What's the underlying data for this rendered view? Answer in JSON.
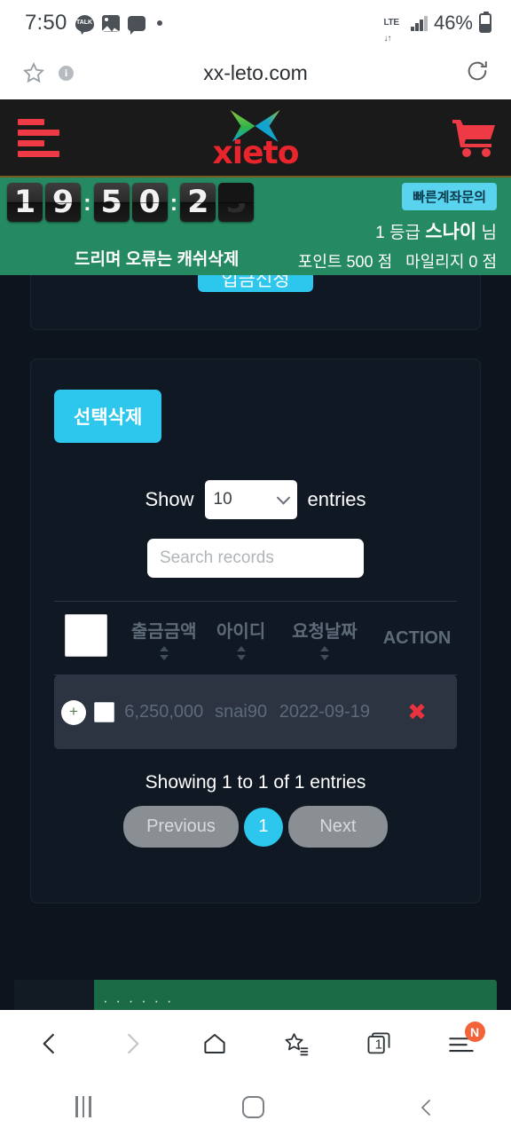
{
  "status_bar": {
    "time": "7:50",
    "icons": [
      "kakaotalk-icon",
      "gallery-icon",
      "message-icon",
      "dot-icon"
    ],
    "network": "LTE",
    "battery_percent": "46%"
  },
  "browser": {
    "url": "xx-leto.com",
    "star_icon": "bookmark-star-icon",
    "info_icon": "page-info-icon",
    "reload_icon": "reload-icon",
    "bottom": {
      "back": "back-arrow-icon",
      "forward": "forward-arrow-icon",
      "home": "home-icon",
      "bookmarks": "bookmarks-star-icon",
      "tabs_count": "1",
      "menu_badge": "N"
    }
  },
  "site_header": {
    "menu_icon": "hamburger-menu-icon",
    "logo_text": "xieto",
    "cart_icon": "shopping-cart-icon"
  },
  "banner": {
    "clock": {
      "hours": "19",
      "minutes": "50",
      "seconds": "25",
      "separator": ":"
    },
    "notice": "드리며 오류는 캐쉬삭제",
    "quick_button": "빠른계좌문의",
    "grade_prefix": "1 등급",
    "username": "스나이",
    "username_suffix": "님",
    "points_label": "포인트",
    "points_value": "500",
    "points_unit": "점",
    "mileage_label": "마일리지",
    "mileage_value": "0",
    "mileage_unit": "점"
  },
  "panel": {
    "cut_button_label": "입금신청",
    "delete_selected_label": "선택삭제",
    "length_prefix": "Show",
    "length_value": "10",
    "length_suffix": "entries",
    "search_placeholder": "Search records",
    "search_value": ""
  },
  "table": {
    "columns": [
      {
        "label": "",
        "name": "select-all"
      },
      {
        "label": "출금금액",
        "name": "amount"
      },
      {
        "label": "아이디",
        "name": "userid"
      },
      {
        "label": "요청날짜",
        "name": "request-date"
      },
      {
        "label": "ACTION",
        "name": "action"
      }
    ],
    "rows": [
      {
        "amount": "6,250,000",
        "userid": "snai90",
        "date": "2022-09-19",
        "action_icon": "delete-x-icon",
        "expand_label": "+"
      }
    ],
    "info": "Showing 1 to 1 of 1 entries",
    "pagination": {
      "previous": "Previous",
      "current_page": "1",
      "next": "Next"
    }
  },
  "footer": {
    "dots": "· · · · · ·"
  },
  "colors": {
    "accent_cyan": "#2dc6ed",
    "banner_green": "#258a62",
    "brand_red": "#e8242c",
    "danger_red": "#e8333f",
    "page_bg": "#0d141d",
    "row_bg": "#2b3440",
    "badge_orange": "#f4623a"
  }
}
